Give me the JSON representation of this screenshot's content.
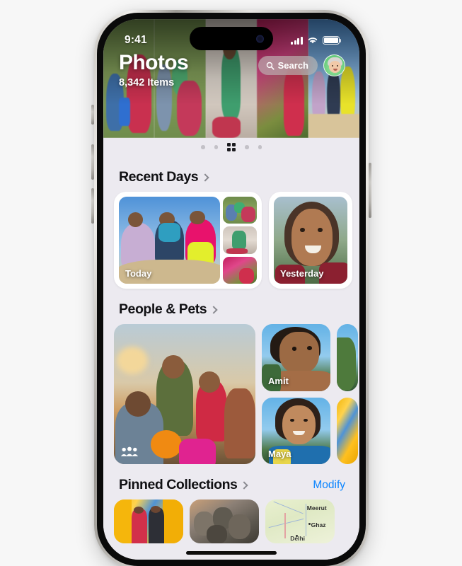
{
  "device": {
    "name": "iPhone",
    "frame_color": "#d8d5d0"
  },
  "statusbar": {
    "time": "9:41",
    "cellular_icon": "cellular-bars-icon",
    "wifi_icon": "wifi-icon",
    "battery_icon": "battery-full-icon"
  },
  "header": {
    "title": "Photos",
    "item_count": "8,342 Items",
    "search": {
      "label": "Search",
      "icon": "search-icon"
    },
    "avatar": {
      "name": "profile-avatar",
      "background": "#63c97a"
    }
  },
  "carousel": {
    "indicator_count": 5,
    "active_index": 2,
    "active_icon": "grid-icon"
  },
  "sections": [
    {
      "id": "recent-days",
      "title": "Recent Days",
      "chevron_icon": "chevron-right-icon",
      "action": null,
      "cards": [
        {
          "caption": "Today",
          "thumbs": 3
        },
        {
          "caption": "Yesterday",
          "thumbs": 0
        }
      ]
    },
    {
      "id": "people-and-pets",
      "title": "People & Pets",
      "chevron_icon": "chevron-right-icon",
      "action": null,
      "cards": [
        {
          "caption": "",
          "badge_icon": "group-people-icon"
        },
        {
          "caption": "Amit"
        },
        {
          "caption": "Maya"
        }
      ]
    },
    {
      "id": "pinned-collections",
      "title": "Pinned Collections",
      "chevron_icon": "chevron-right-icon",
      "action": {
        "label": "Modify",
        "color": "#0a84ff"
      },
      "cards": [
        {
          "caption": ""
        },
        {
          "caption": ""
        },
        {
          "caption": "",
          "map_labels": [
            "Meerut",
            "Ghaz",
            "Delhi"
          ]
        }
      ]
    }
  ],
  "map": {
    "city_1": "Meerut",
    "city_2": "Ghaz",
    "city_3": "Delhi"
  },
  "home_indicator": "home-indicator"
}
